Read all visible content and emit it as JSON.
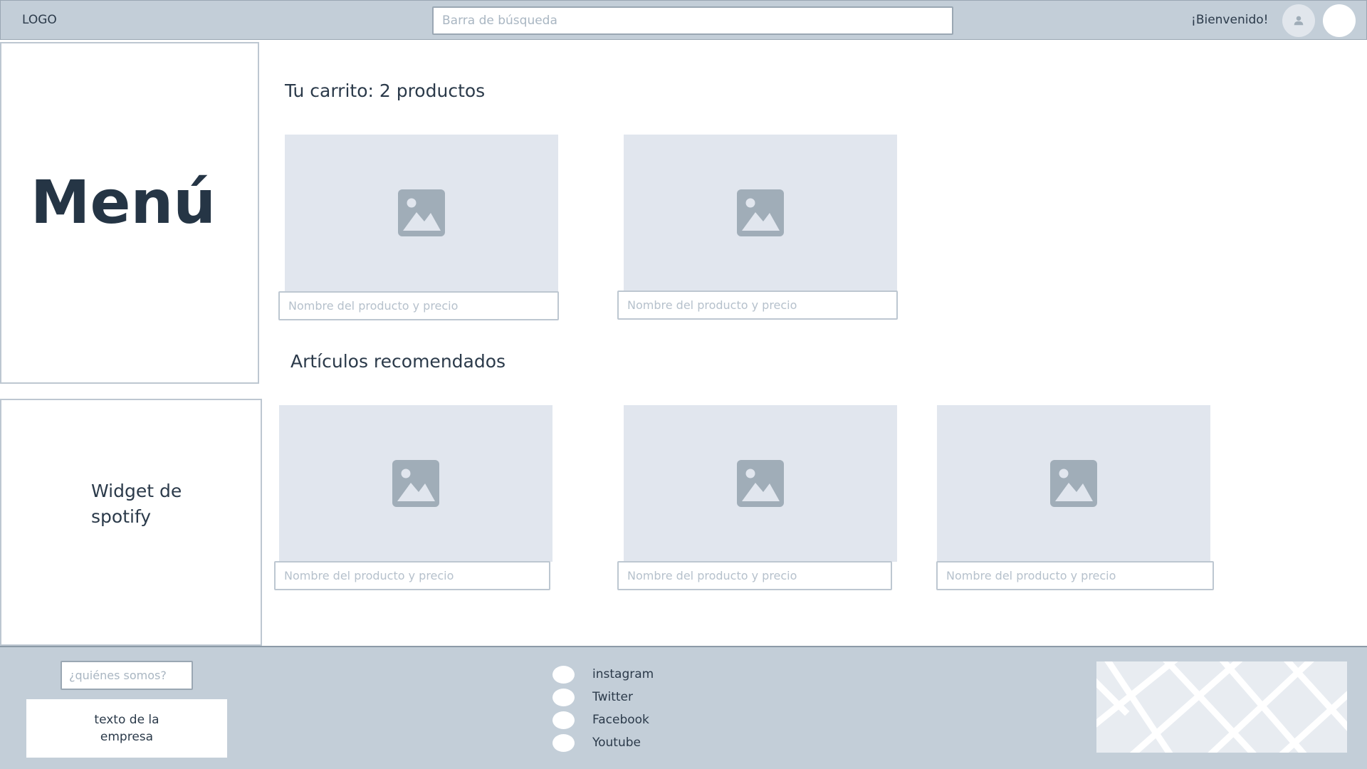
{
  "header": {
    "logo": "LOGO",
    "search_placeholder": "Barra de búsqueda",
    "welcome": "¡Bienvenido!"
  },
  "sidebar": {
    "menu_title": "Menú",
    "widget_text": "Widget de spotify"
  },
  "cart": {
    "title": "Tu carrito: 2 productos",
    "items": [
      {
        "placeholder": "Nombre del producto y precio"
      },
      {
        "placeholder": "Nombre del producto y precio"
      }
    ]
  },
  "recommended": {
    "title": "Artículos recomendados",
    "items": [
      {
        "placeholder": "Nombre del producto y precio"
      },
      {
        "placeholder": "Nombre del producto y precio"
      },
      {
        "placeholder": "Nombre del producto y precio"
      }
    ]
  },
  "footer": {
    "about_placeholder": "¿quiénes somos?",
    "company_text": "texto de la empresa",
    "social": [
      "instagram",
      "Twitter",
      "Facebook",
      "Youtube"
    ]
  },
  "colors": {
    "header_bg": "#c3ced8",
    "placeholder_bg": "#e1e6ee",
    "image_icon": "#a0adb8",
    "text": "#2b3a4a"
  }
}
